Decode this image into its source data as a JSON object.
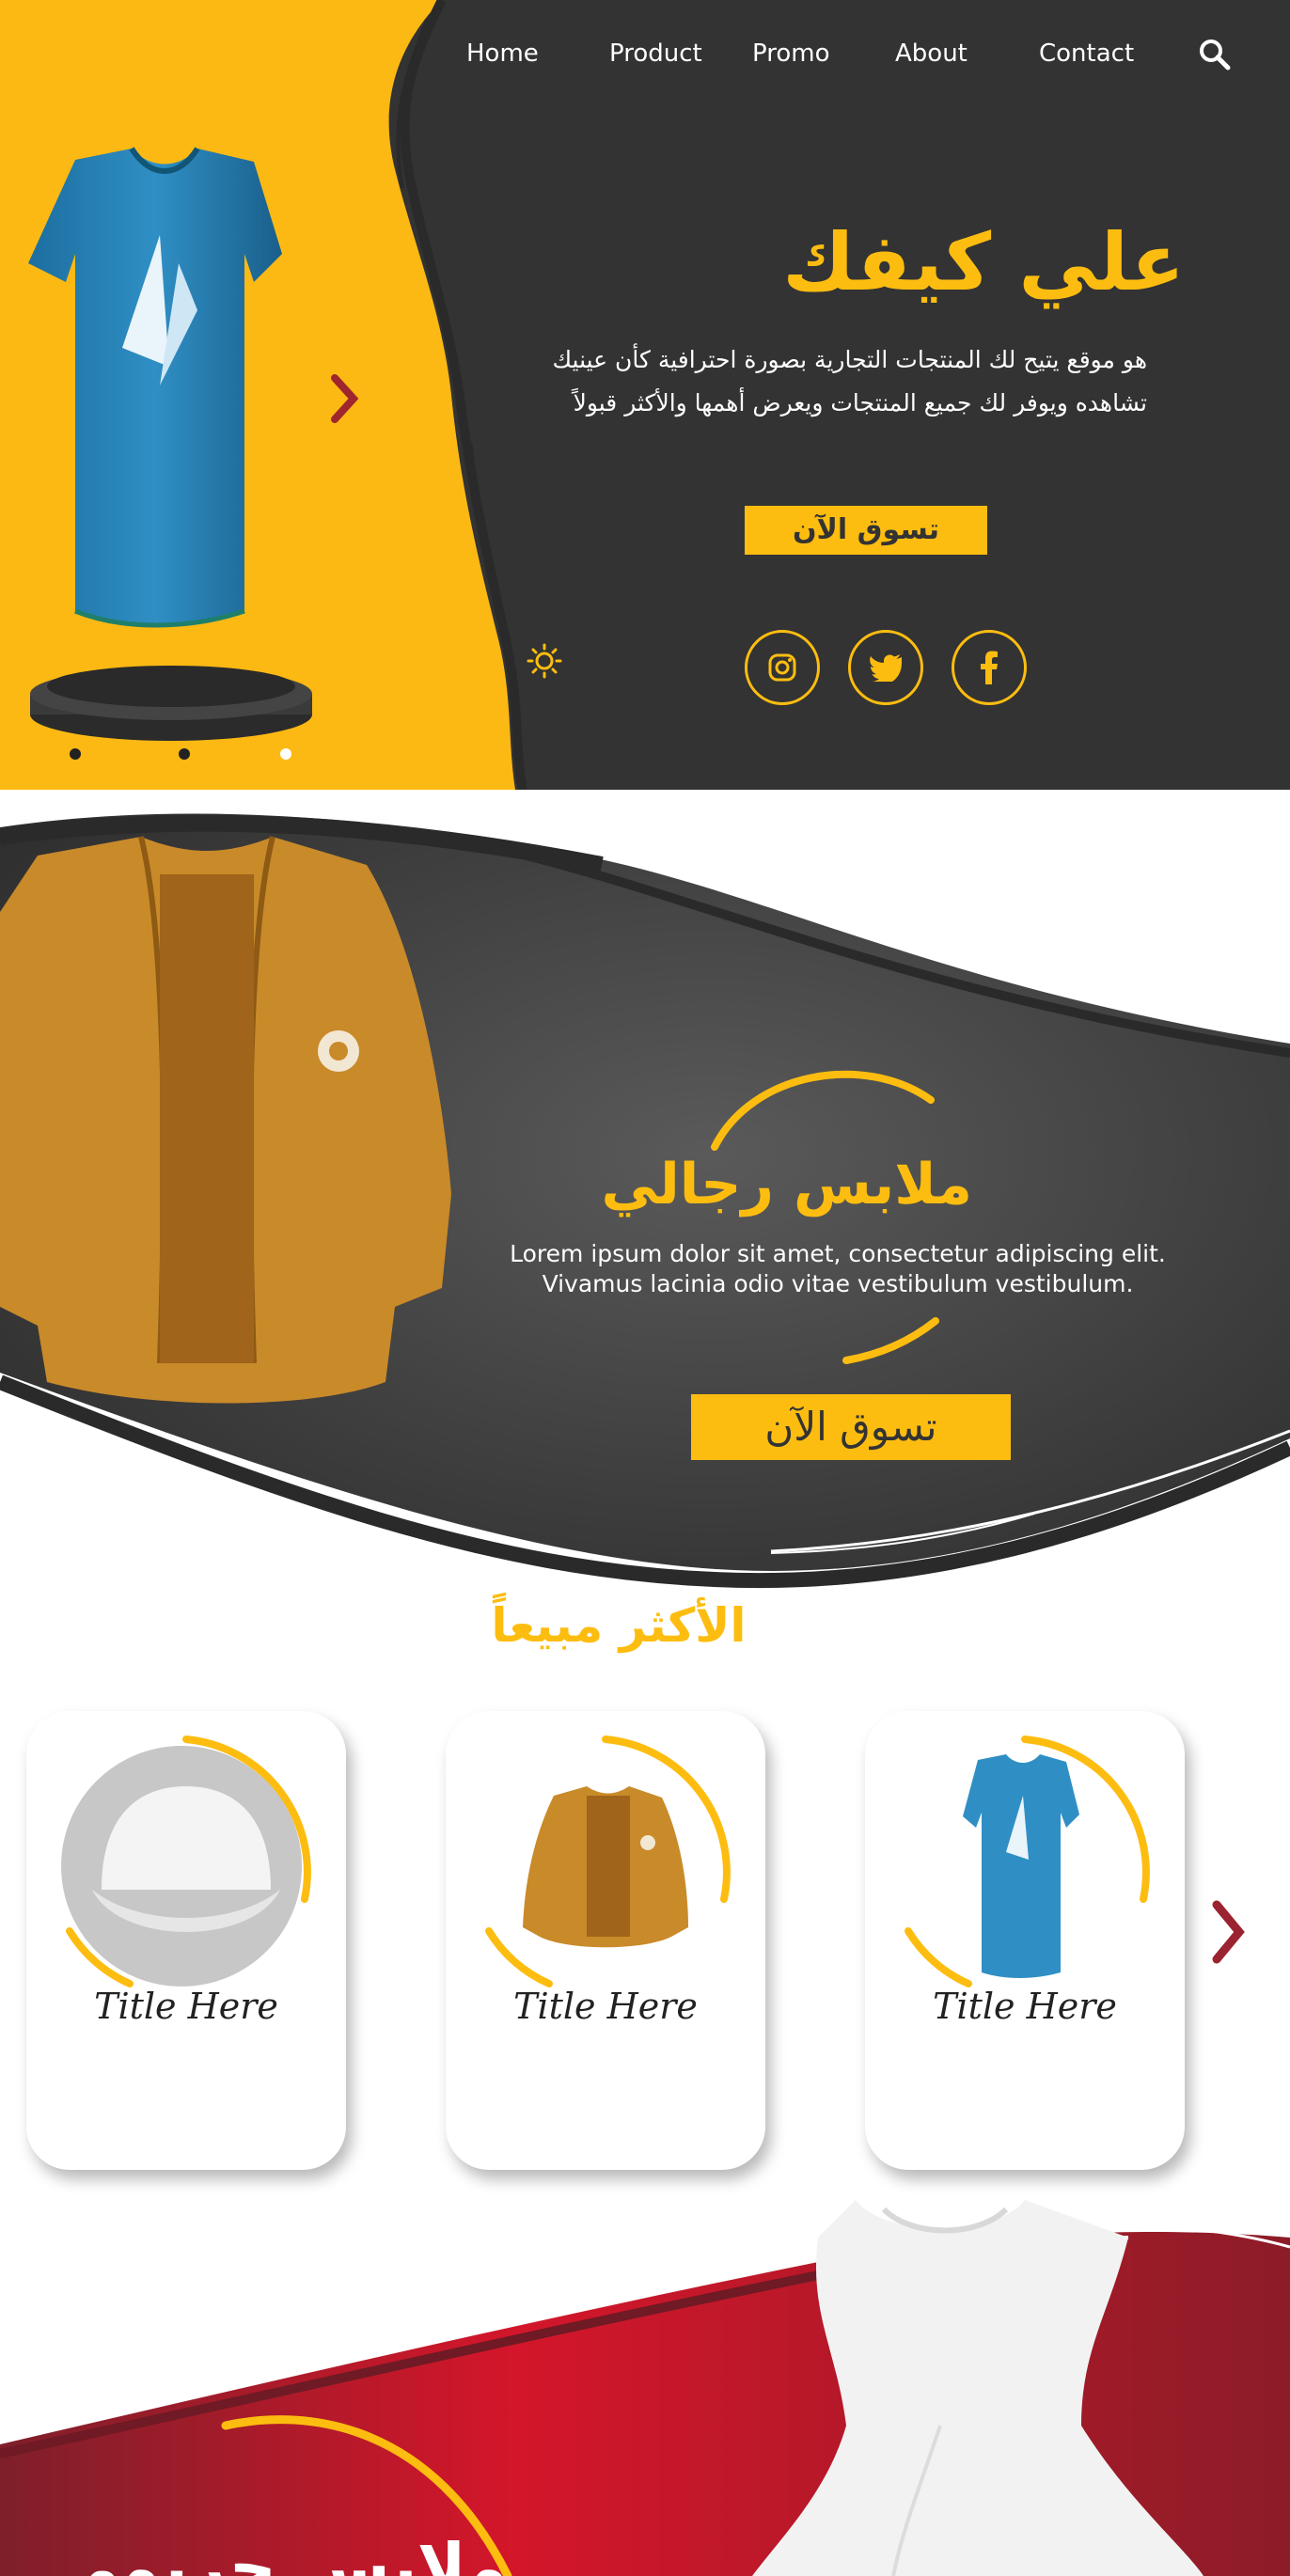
{
  "nav": {
    "items": [
      "Home",
      "Product",
      "Promo",
      "About",
      "Contact"
    ],
    "search_icon": "search-icon"
  },
  "hero": {
    "title": "علي كيفك",
    "description_line1": "هو موقع  يتيح لك  المنتجات التجارية بصورة احترافية كأن عينيك",
    "description_line2": "تشاهده ويوفر لك جميع المنتجات  ويعرض  أهمها والأكثر قبولاً",
    "cta": "تسوق الآن",
    "social": [
      "instagram-icon",
      "twitter-icon",
      "facebook-icon"
    ],
    "slide_count": 3,
    "active_slide": 3
  },
  "men": {
    "title": "ملابس رجالي",
    "text_line1": "Lorem ipsum dolor sit amet, consectetur adipiscing elit.",
    "text_line2": "Vivamus lacinia odio vitae vestibulum vestibulum.",
    "cta": "تسوق الآن"
  },
  "best_sellers": {
    "title": "الأكثر مبيعاً",
    "cards": [
      {
        "title": "Title Here",
        "product": "cap"
      },
      {
        "title": "Title Here",
        "product": "jacket"
      },
      {
        "title": "Title Here",
        "product": "tshirt"
      }
    ]
  },
  "women": {
    "title": "ملابس حريمي"
  },
  "colors": {
    "accent": "#fdbd10",
    "dark": "#333333",
    "red": "#c8182a",
    "arrow": "#9b2230"
  }
}
